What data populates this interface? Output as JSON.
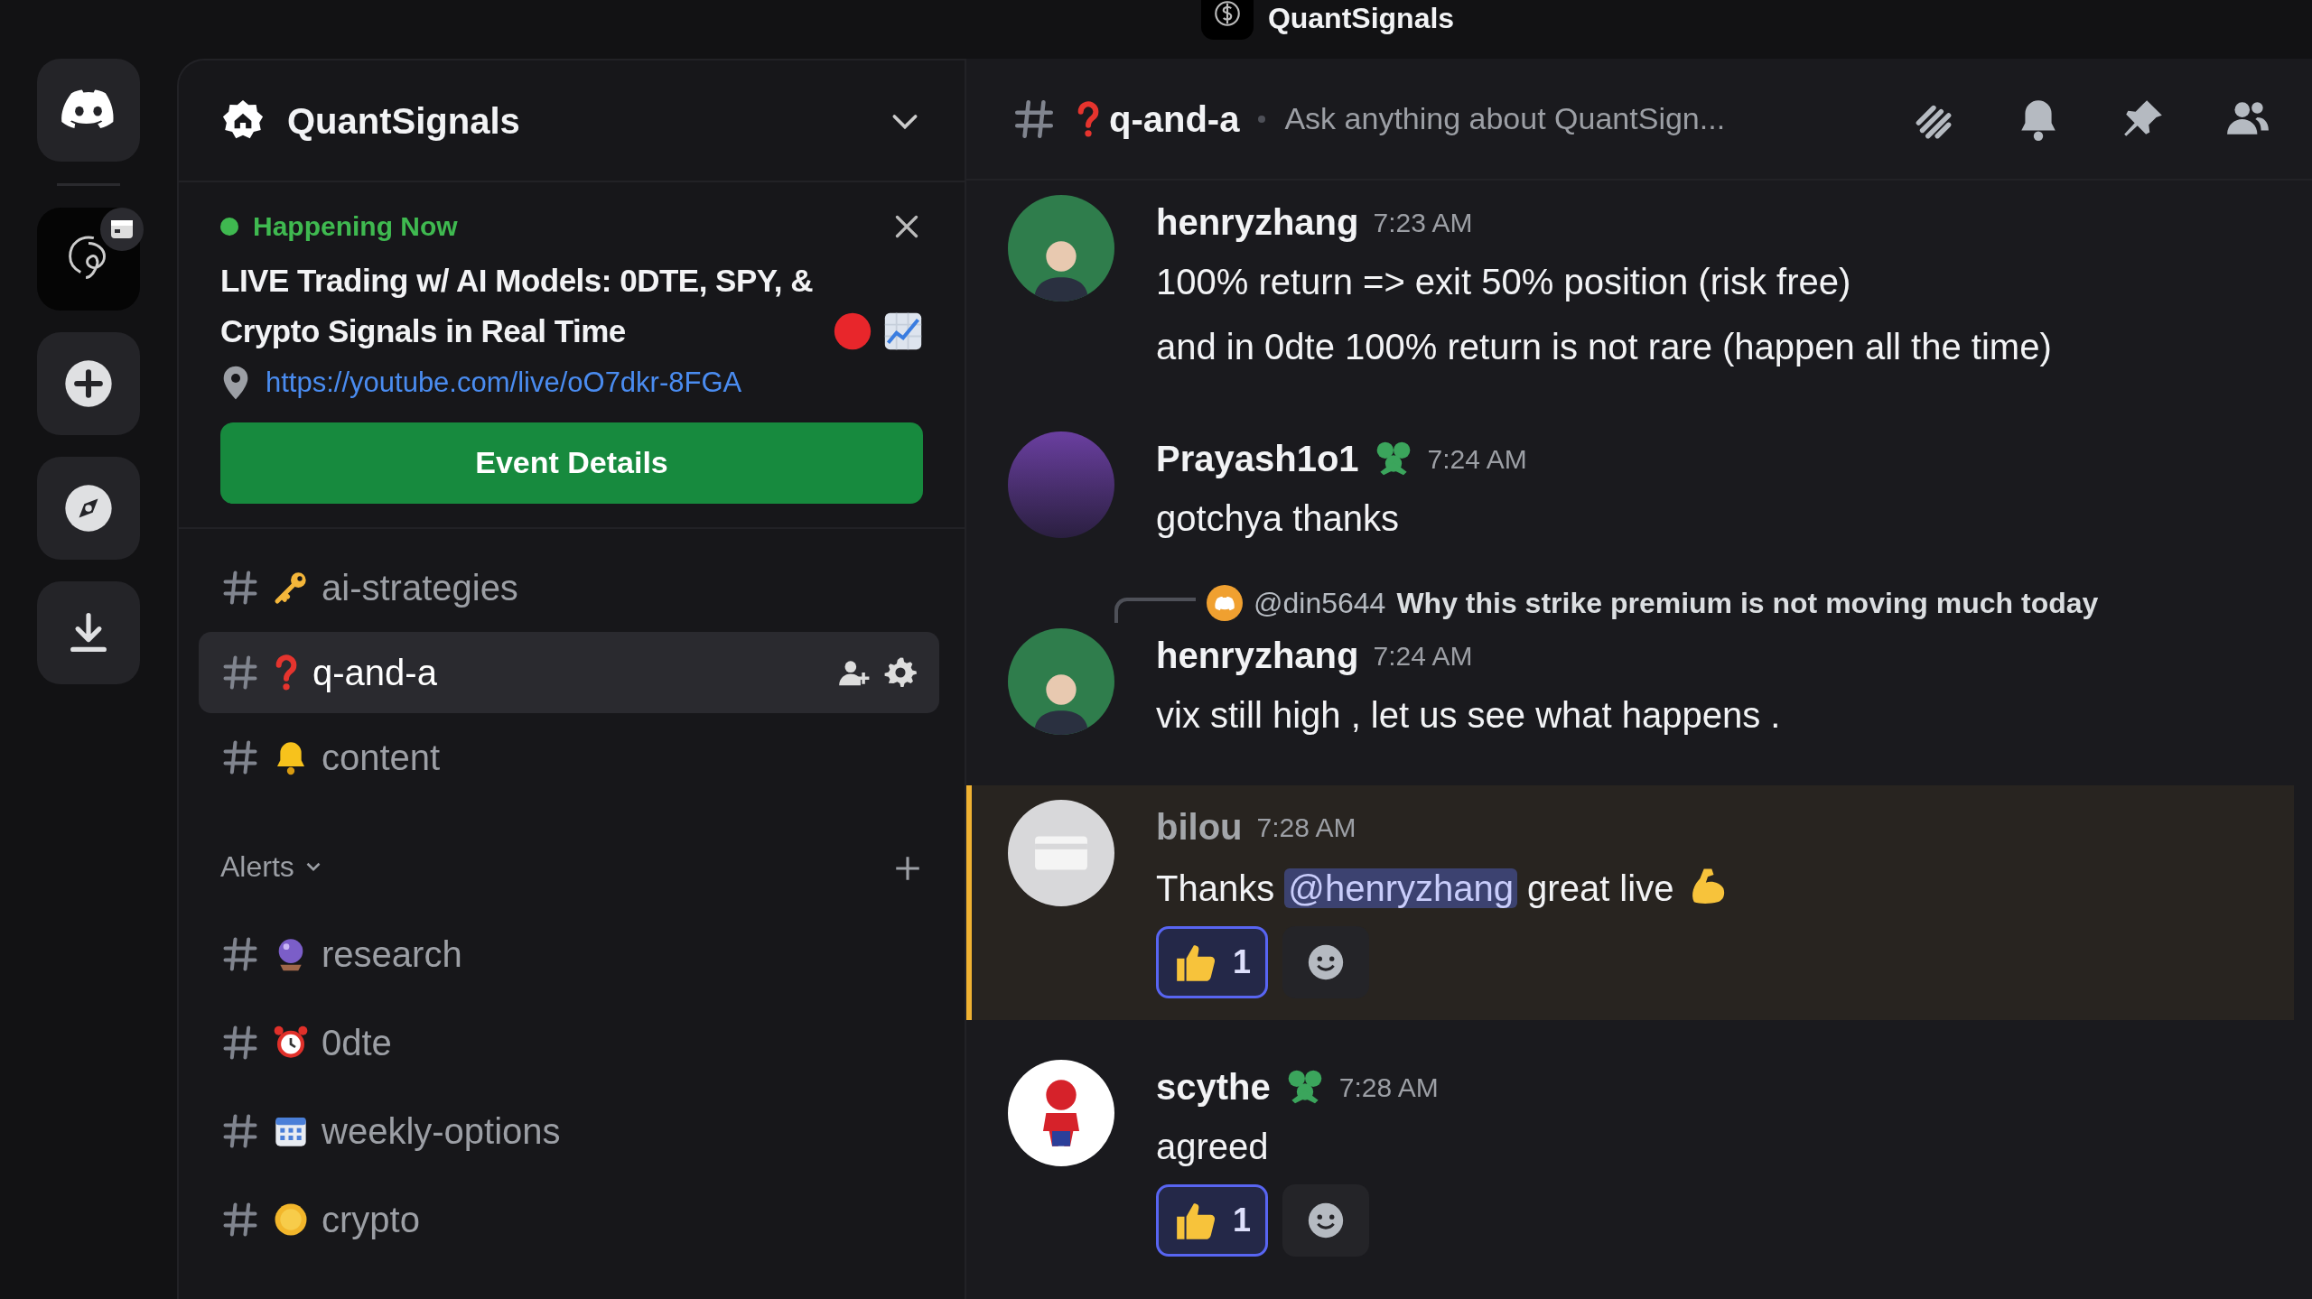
{
  "window": {
    "title": "QuantSignals"
  },
  "server": {
    "name": "QuantSignals"
  },
  "event": {
    "status": "Happening Now",
    "title": "LIVE Trading w/ AI Models: 0DTE, SPY, & Crypto Signals in Real Time",
    "link": "https://youtube.com/live/oO7dkr-8FGA",
    "button": "Event Details"
  },
  "channels": [
    {
      "name": "ai-strategies",
      "selected": false
    },
    {
      "name": "q-and-a",
      "selected": true
    },
    {
      "name": "content",
      "selected": false
    }
  ],
  "category": {
    "name": "Alerts",
    "expanded": true,
    "channels": [
      {
        "name": "research",
        "selected": false
      },
      {
        "name": "0dte",
        "selected": false
      },
      {
        "name": "weekly-options",
        "selected": false
      },
      {
        "name": "crypto",
        "selected": false
      }
    ]
  },
  "channel_header": {
    "name": "q-and-a",
    "topic": "Ask anything about QuantSign..."
  },
  "messages": [
    {
      "author": "henryzhang",
      "color": "#f2f3f5",
      "badge": false,
      "time": "7:23 AM",
      "highlighted": false,
      "lines": [
        "100% return => exit 50% position (risk free)",
        "and in 0dte 100% return is not rare (happen all the time)"
      ]
    },
    {
      "author": "Prayash1o1",
      "color": "#f2f3f5",
      "badge": true,
      "time": "7:24 AM",
      "highlighted": false,
      "lines": [
        "gotchya thanks"
      ]
    },
    {
      "author": "henryzhang",
      "color": "#f2f3f5",
      "badge": false,
      "time": "7:24 AM",
      "highlighted": false,
      "reply": {
        "author": "@din5644",
        "text": "Why this strike premium is not moving much today"
      },
      "lines": [
        "vix still high , let us see what happens ."
      ]
    },
    {
      "author": "bilou",
      "color": "#a3a6aa",
      "badge": false,
      "time": "7:28 AM",
      "highlighted": true,
      "parts": [
        {
          "kind": "text",
          "text": "Thanks "
        },
        {
          "kind": "mention",
          "text": "@henryzhang"
        },
        {
          "kind": "text",
          "text": " great live"
        }
      ],
      "reactions": [
        {
          "count": "1",
          "reacted": true
        }
      ]
    },
    {
      "author": "scythe",
      "color": "#f2f3f5",
      "badge": true,
      "time": "7:28 AM",
      "highlighted": false,
      "lines": [
        "agreed"
      ],
      "reactions": [
        {
          "count": "1",
          "reacted": true
        }
      ]
    }
  ]
}
